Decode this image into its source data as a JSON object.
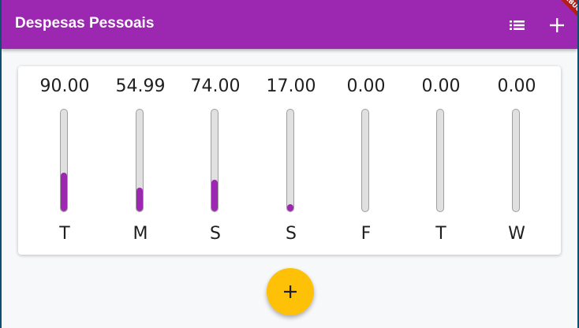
{
  "app": {
    "title": "Despesas Pessoais",
    "debug_banner": "DEBUG",
    "accent_color": "#9c27b0",
    "fab_color": "#ffc107"
  },
  "appbar": {
    "actions": [
      {
        "icon": "list-icon"
      },
      {
        "icon": "add-icon"
      }
    ]
  },
  "chart": {
    "bars": [
      {
        "amount": "90.00",
        "day": "T",
        "fill": 0.38
      },
      {
        "amount": "54.99",
        "day": "M",
        "fill": 0.23
      },
      {
        "amount": "74.00",
        "day": "S",
        "fill": 0.31
      },
      {
        "amount": "17.00",
        "day": "S",
        "fill": 0.07
      },
      {
        "amount": "0.00",
        "day": "F",
        "fill": 0
      },
      {
        "amount": "0.00",
        "day": "T",
        "fill": 0
      },
      {
        "amount": "0.00",
        "day": "W",
        "fill": 0
      }
    ]
  },
  "fab": {
    "icon": "add-icon"
  }
}
